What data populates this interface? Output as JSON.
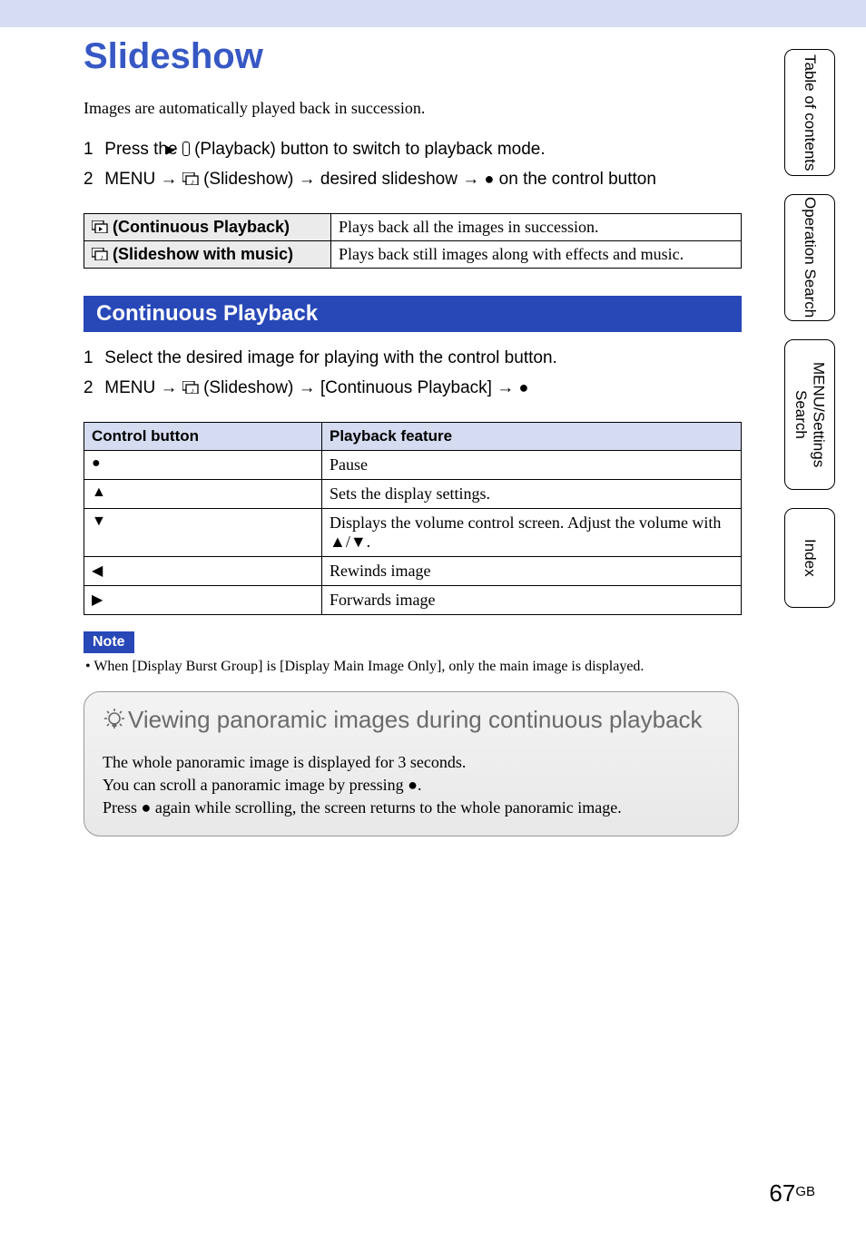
{
  "title": "Slideshow",
  "intro": "Images are automatically played back in succession.",
  "steps_main": [
    {
      "num": "1",
      "pre": "Press the ",
      "mid": " (Playback) button to switch to playback mode."
    },
    {
      "num": "2",
      "pre": "MENU ",
      "mid": " (Slideshow) ",
      "mid2": " desired slideshow ",
      "mid3": " on the control button"
    }
  ],
  "opts": [
    {
      "label": " (Continuous Playback)",
      "desc": "Plays back all the images in succession."
    },
    {
      "label": " (Slideshow with music)",
      "desc": "Plays back still images along with effects and music."
    }
  ],
  "section_bar": "Continuous Playback",
  "steps_cp": [
    {
      "num": "1",
      "text": "Select the desired image for playing with the control button."
    },
    {
      "num": "2",
      "pre": "MENU ",
      "mid": " (Slideshow) ",
      "mid2": " [Continuous Playback] "
    }
  ],
  "ctrl_table": {
    "h1": "Control button",
    "h2": "Playback feature",
    "rows": [
      {
        "sym": "●",
        "desc": "Pause"
      },
      {
        "sym": "▲",
        "desc": "Sets the display settings."
      },
      {
        "sym": "▼",
        "desc": "Displays the volume control screen. Adjust the volume with ▲/▼."
      },
      {
        "sym": "◀",
        "desc": "Rewinds image"
      },
      {
        "sym": "▶",
        "desc": "Forwards image"
      }
    ]
  },
  "note_label": "Note",
  "note_text": "•  When [Display Burst Group] is [Display Main Image Only], only the main image is displayed.",
  "tip": {
    "title": "Viewing panoramic images during continuous playback",
    "p1": "The whole panoramic image is displayed for 3 seconds.",
    "p2a": "You can scroll a panoramic image by pressing ",
    "p2b": ".",
    "p3a": "Press ",
    "p3b": " again while scrolling, the screen returns to the whole panoramic image."
  },
  "tabs": {
    "t1": "Table of contents",
    "t2": "Operation Search",
    "t3": "MENU/Settings Search",
    "t4": "Index"
  },
  "page": {
    "num": "67",
    "suffix": "GB"
  }
}
